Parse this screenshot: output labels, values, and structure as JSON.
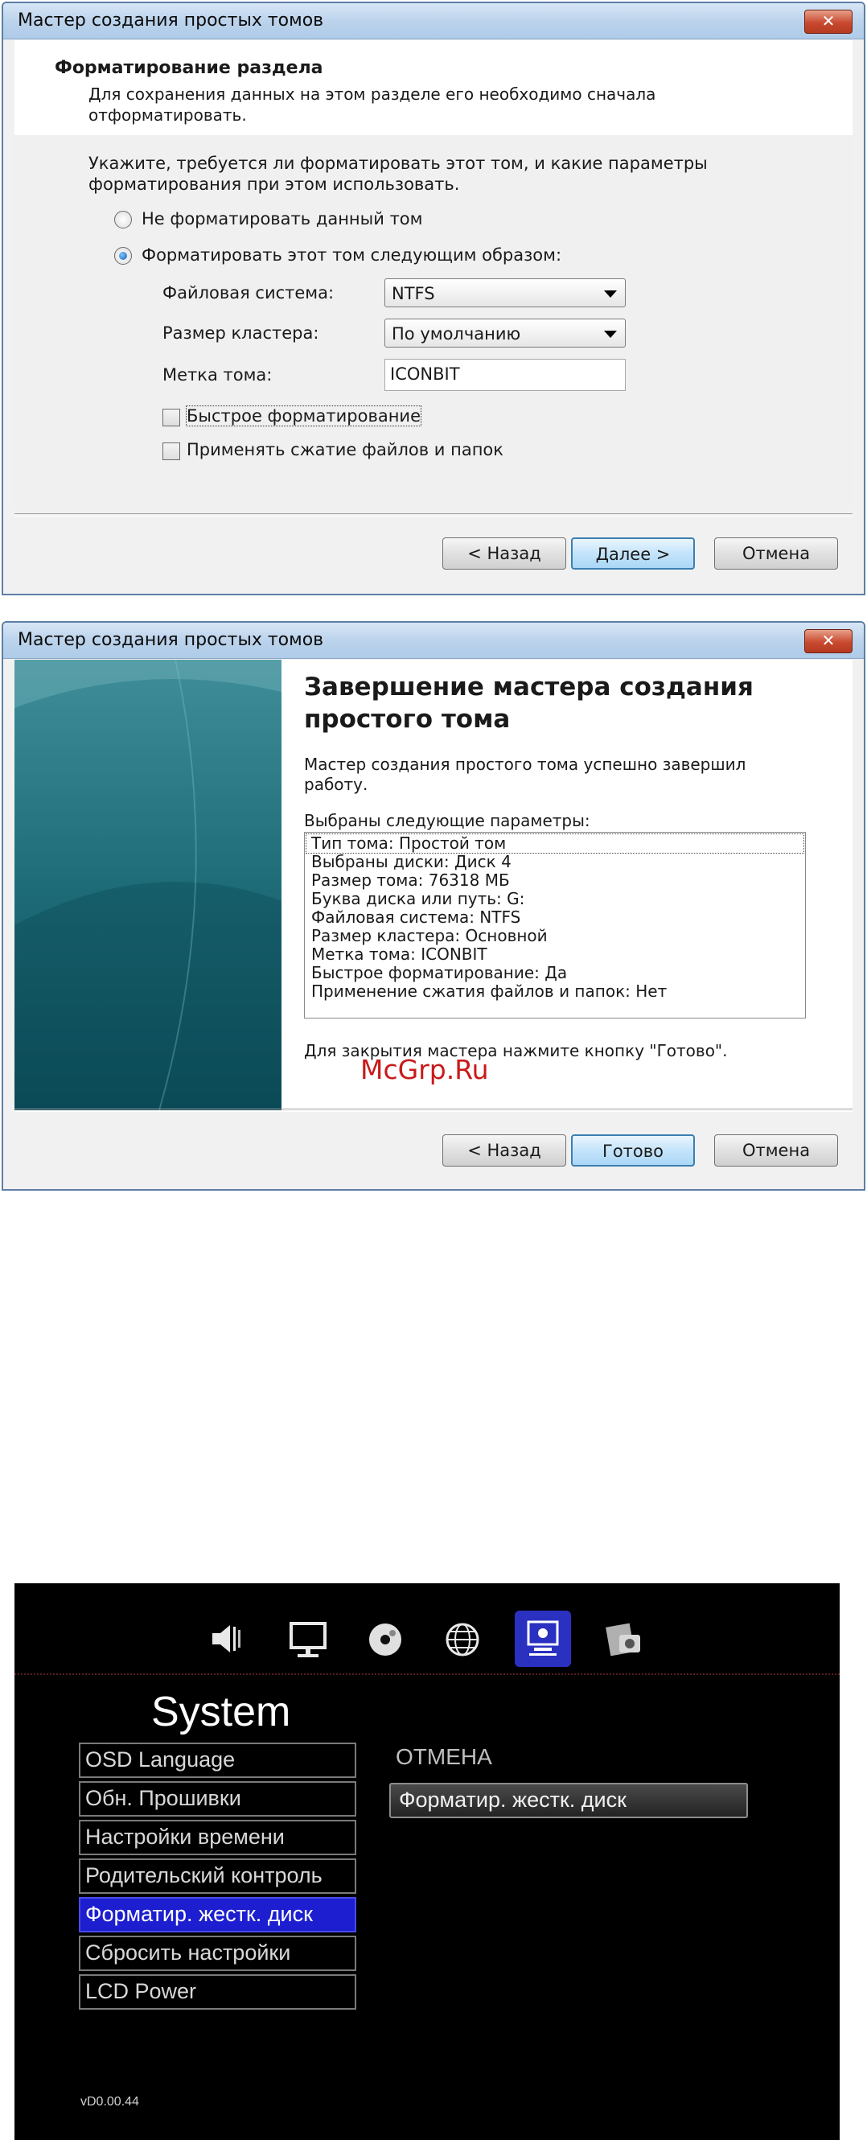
{
  "wizard1": {
    "title": "Мастер создания простых томов",
    "close": "✕",
    "header_title": "Форматирование раздела",
    "header_subtitle": "Для сохранения данных на этом разделе его необходимо сначала отформатировать.",
    "instruction": "Укажите, требуется ли форматировать этот том, и какие параметры форматирования при этом использовать.",
    "option_no_format": "Не форматировать данный том",
    "option_format": "Форматировать этот том следующим образом:",
    "fs_label": "Файловая система:",
    "fs_value": "NTFS",
    "cluster_label": "Размер кластера:",
    "cluster_value": "По умолчанию",
    "volume_label": "Метка тома:",
    "volume_value": "ICONBIT",
    "quick_format": "Быстрое форматирование",
    "compression": "Применять сжатие файлов и папок",
    "btn_back": "< Назад",
    "btn_next": "Далее >",
    "btn_cancel": "Отмена"
  },
  "wizard2": {
    "title": "Мастер создания простых томов",
    "close": "✕",
    "heading": "Завершение мастера создания простого тома",
    "success_text": "Мастер создания простого тома успешно завершил работу.",
    "params_label": "Выбраны следующие параметры:",
    "params": [
      "Тип тома: Простой том",
      "Выбраны диски: Диск 4",
      "Размер тома: 76318 МБ",
      "Буква диска или путь: G:",
      "Файловая система: NTFS",
      "Размер кластера: Основной",
      "Метка тома: ICONBIT",
      "Быстрое форматирование: Да",
      "Применение сжатия файлов и папок: Нет"
    ],
    "close_hint": "Для закрытия мастера нажмите кнопку \"Готово\".",
    "watermark": "McGrp.Ru",
    "btn_back": "< Назад",
    "btn_finish": "Готово",
    "btn_cancel": "Отмена"
  },
  "tv_menu": {
    "icons": [
      "speaker-icon",
      "monitor-icon",
      "disc-icon",
      "globe-icon",
      "system-icon",
      "photo-icon"
    ],
    "title": "System",
    "items": [
      "OSD Language",
      "Обн. Прошивки",
      "Настройки времени",
      "Родительский контроль",
      "Форматир. жестк. диск",
      "Сбросить настройки",
      "LCD Power"
    ],
    "selected_index": 4,
    "right_label": "ОТМЕНА",
    "right_button": "Форматир. жестк. диск",
    "version": "vD0.00.44"
  }
}
